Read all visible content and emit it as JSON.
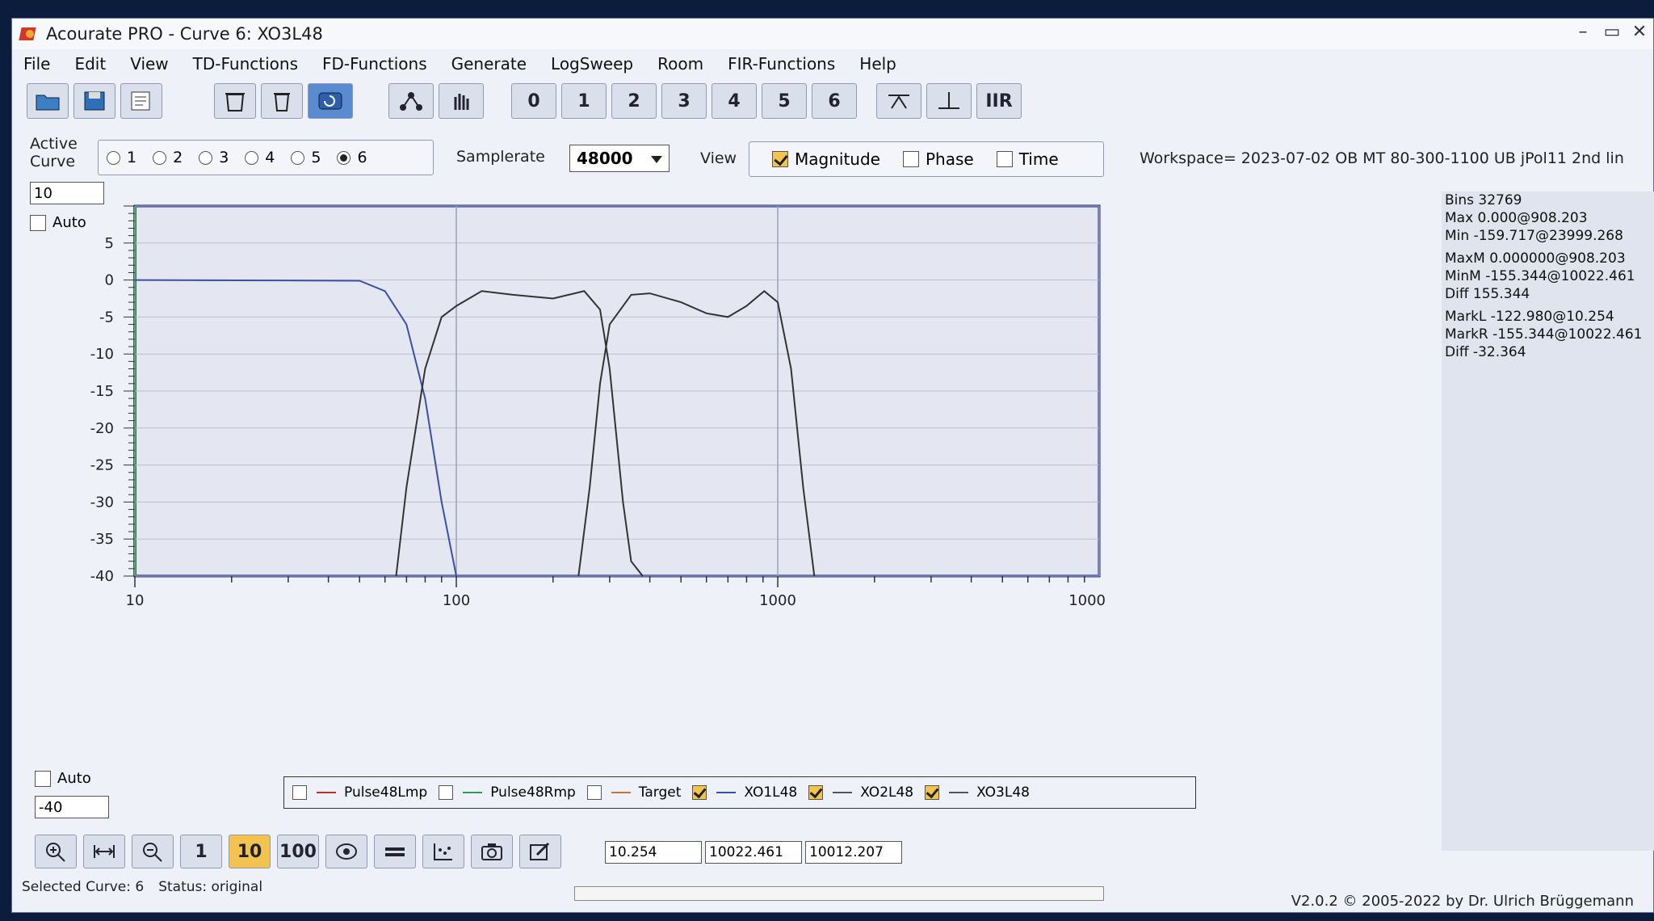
{
  "window": {
    "title": "Acourate PRO - Curve 6: XO3L48"
  },
  "menu": [
    "File",
    "Edit",
    "View",
    "TD-Functions",
    "FD-Functions",
    "Generate",
    "LogSweep",
    "Room",
    "FIR-Functions",
    "Help"
  ],
  "toolbar": {
    "curve_buttons": [
      "0",
      "1",
      "2",
      "3",
      "4",
      "5",
      "6"
    ],
    "iir_label": "IIR",
    "icons": [
      "open-icon",
      "save-icon",
      "properties-icon",
      "delete-all-icon",
      "delete-icon",
      "undo-icon",
      "network-icon",
      "hand-icon",
      "peak-icon",
      "pulse-icon"
    ]
  },
  "options": {
    "active_curve_label_1": "Active",
    "active_curve_label_2": "Curve",
    "curves": [
      "1",
      "2",
      "3",
      "4",
      "5",
      "6"
    ],
    "selected_curve": "6",
    "samplerate_label": "Samplerate",
    "samplerate_value": "48000",
    "view_label": "View",
    "view_magnitude": "Magnitude",
    "view_phase": "Phase",
    "view_time": "Time",
    "workspace": "Workspace=  2023-07-02 OB MT 80-300-1100 UB jPol11 2nd lin"
  },
  "y_top_field": "10",
  "y_bottom_field": "-40",
  "auto_label": "Auto",
  "stats": [
    "Bins 32769",
    "Max 0.000@908.203",
    "Min -159.717@23999.268",
    "MaxM 0.000000@908.203",
    "MinM -155.344@10022.461",
    "Diff 155.344",
    "MarkL -122.980@10.254",
    "MarkR -155.344@10022.461",
    "Diff -32.364"
  ],
  "chart_data": {
    "type": "line",
    "x_scale": "log",
    "xlim": [
      10,
      10000
    ],
    "ylim": [
      -40,
      10
    ],
    "x_ticks": [
      "10",
      "100",
      "1000",
      "1000"
    ],
    "y_ticks": [
      "5",
      "0",
      "-5",
      "-10",
      "-15",
      "-20",
      "-25",
      "-30",
      "-35",
      "-40"
    ],
    "series": [
      {
        "name": "XO1L48",
        "color": "#3a4fa8",
        "x": [
          10,
          50,
          60,
          70,
          80,
          90,
          100
        ],
        "y": [
          0,
          -0.1,
          -1.5,
          -6,
          -16,
          -30,
          -40
        ]
      },
      {
        "name": "XO2L48",
        "color": "#333333",
        "x": [
          65,
          70,
          80,
          90,
          100,
          120,
          150,
          200,
          250,
          280,
          300,
          330,
          350,
          380
        ],
        "y": [
          -40,
          -28,
          -12,
          -5,
          -3.5,
          -1.5,
          -2,
          -2.5,
          -1.5,
          -4,
          -12,
          -30,
          -38,
          -40
        ]
      },
      {
        "name": "XO3L48",
        "color": "#333333",
        "x": [
          240,
          260,
          280,
          300,
          350,
          400,
          500,
          600,
          700,
          800,
          908,
          1000,
          1100,
          1200,
          1300
        ],
        "y": [
          -40,
          -28,
          -14,
          -6,
          -2,
          -1.8,
          -3,
          -4.5,
          -5,
          -3.5,
          -1.5,
          -3,
          -12,
          -28,
          -40
        ]
      }
    ],
    "legend": [
      {
        "name": "Pulse48Lmp",
        "color": "#c0302a",
        "checked": false
      },
      {
        "name": "Pulse48Rmp",
        "color": "#2a9a5a",
        "checked": false
      },
      {
        "name": "Target",
        "color": "#c4763a",
        "checked": false
      },
      {
        "name": "XO1L48",
        "color": "#3a4fa8",
        "checked": true
      },
      {
        "name": "XO2L48",
        "color": "#555555",
        "checked": true
      },
      {
        "name": "XO3L48",
        "color": "#555555",
        "checked": true
      }
    ]
  },
  "bottom": {
    "zoom_buttons": [
      "1",
      "10",
      "100"
    ],
    "active_zoom": "10",
    "readouts": [
      "10.254",
      "10022.461",
      "10012.207"
    ]
  },
  "status": {
    "selected": "Selected Curve: 6",
    "state": "Status: original",
    "version": "V2.0.2 © 2005-2022 by Dr. Ulrich Brüggemann"
  }
}
